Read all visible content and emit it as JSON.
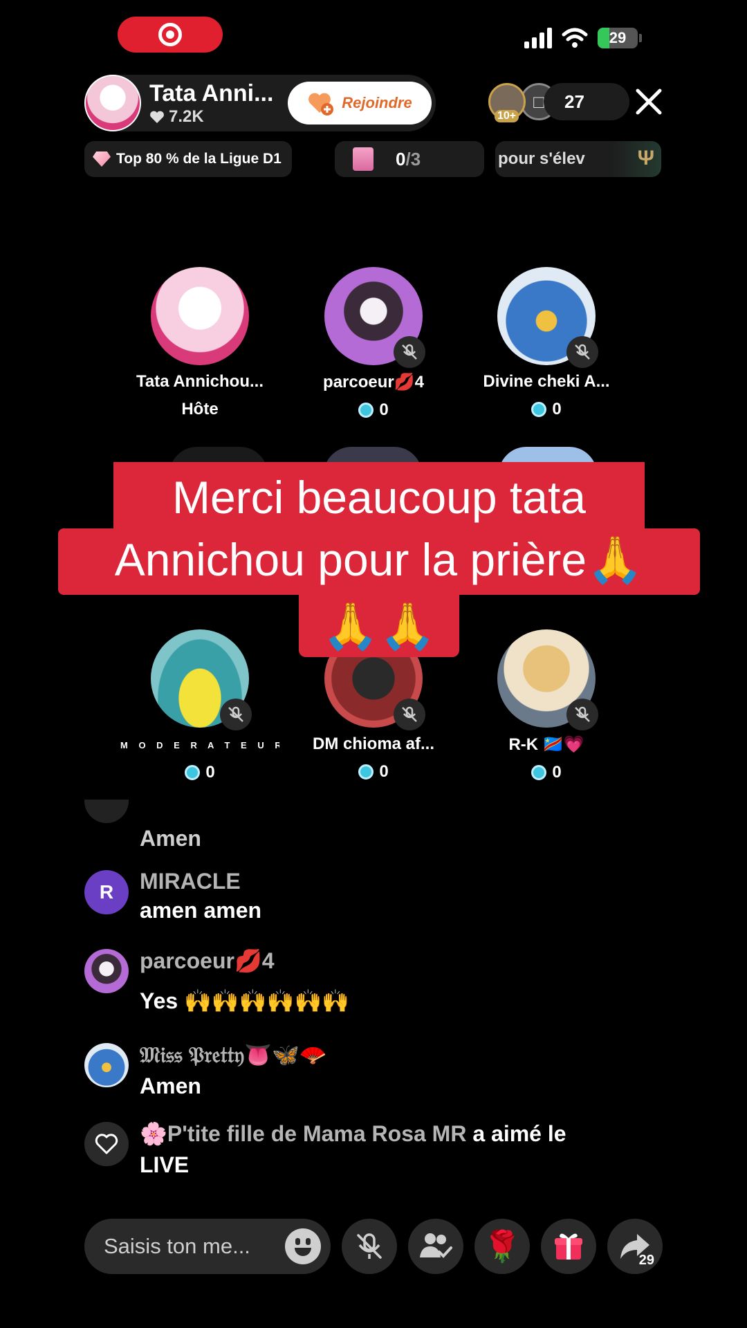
{
  "status_bar": {
    "battery": "29",
    "battery_level": 0.29
  },
  "host": {
    "name": "Tata Anni...",
    "likes": "7.2K",
    "join_label": "Rejoindre"
  },
  "viewers": {
    "badge": "10+",
    "count": "27"
  },
  "league": {
    "label": "Top 80 % de la Ligue D1"
  },
  "tasks": {
    "done": "0",
    "total": "/3"
  },
  "promo": {
    "text": "ger pour s'élev"
  },
  "guests": [
    {
      "name": "Tata Annichou...",
      "sub": "Hôte",
      "muted": false
    },
    {
      "name": "parcoeur💋4",
      "score": "0",
      "muted": true
    },
    {
      "name": "Divine cheki A...",
      "score": "0",
      "muted": true
    },
    {
      "name": "M O D E R A T E U R  D...",
      "score": "0",
      "muted": true
    },
    {
      "name": "DM chioma af...",
      "score": "0",
      "muted": true
    },
    {
      "name": "R-K 🇨🇩💗",
      "score": "0",
      "muted": true
    }
  ],
  "banner": {
    "line1": "Merci beaucoup tata",
    "line2": "Annichou pour la prière🙏",
    "line3": "🙏🙏"
  },
  "chat": [
    {
      "user": "",
      "message": "Amen"
    },
    {
      "user": "MIRACLE",
      "avatar_letter": "R",
      "message": "amen  amen"
    },
    {
      "user": "parcoeur💋4",
      "message": "Yes 🙌🙌🙌🙌🙌🙌"
    },
    {
      "user": "𝔐𝔦𝔰𝔰 𝔓𝔯𝔢𝔱𝔱𝔶👅🦋🪭",
      "message": "Amen"
    },
    {
      "user": "🌸P'tite fille de Mama Rosa MR",
      "action": " a aimé le",
      "message": "LIVE"
    }
  ],
  "input": {
    "placeholder": "Saisis ton me..."
  },
  "share": {
    "count": "29"
  },
  "colors": {
    "accent_red": "#db2739",
    "join_orange": "#e0692a",
    "coin_blue": "#3ec6e0"
  }
}
